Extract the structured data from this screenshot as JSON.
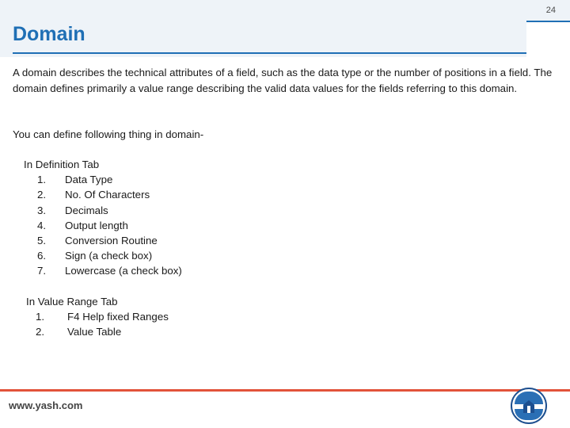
{
  "header": {
    "title": "Domain",
    "slide_number": "24"
  },
  "body": {
    "paragraph": "A domain describes the technical attributes of a field, such as the data type or the number of positions in a field. The domain defines primarily a value range describing the valid data values for the fields referring to this domain.",
    "sub_line": "You can define following thing in domain-",
    "sections": [
      {
        "heading": "In Definition Tab",
        "items": [
          {
            "num": "1.",
            "label": "Data Type"
          },
          {
            "num": "2.",
            "label": "No. Of Characters"
          },
          {
            "num": "3.",
            "label": "Decimals"
          },
          {
            "num": "4.",
            "label": "Output length"
          },
          {
            "num": "5.",
            "label": "Conversion Routine"
          },
          {
            "num": "6.",
            "label": "Sign (a check box)"
          },
          {
            "num": "7.",
            "label": "Lowercase (a check box)"
          }
        ]
      },
      {
        "heading": "In Value Range Tab",
        "items": [
          {
            "num": "1.",
            "label": "F4 Help fixed Ranges"
          },
          {
            "num": "2.",
            "label": "Value Table"
          }
        ]
      }
    ]
  },
  "footer": {
    "url": "www.yash.com",
    "logo_alt": "yash-logo"
  },
  "colors": {
    "title": "#1f6fb5",
    "header_band": "#eef3f8",
    "footer_rule": "#e2533a",
    "text": "#1a1a1a"
  }
}
